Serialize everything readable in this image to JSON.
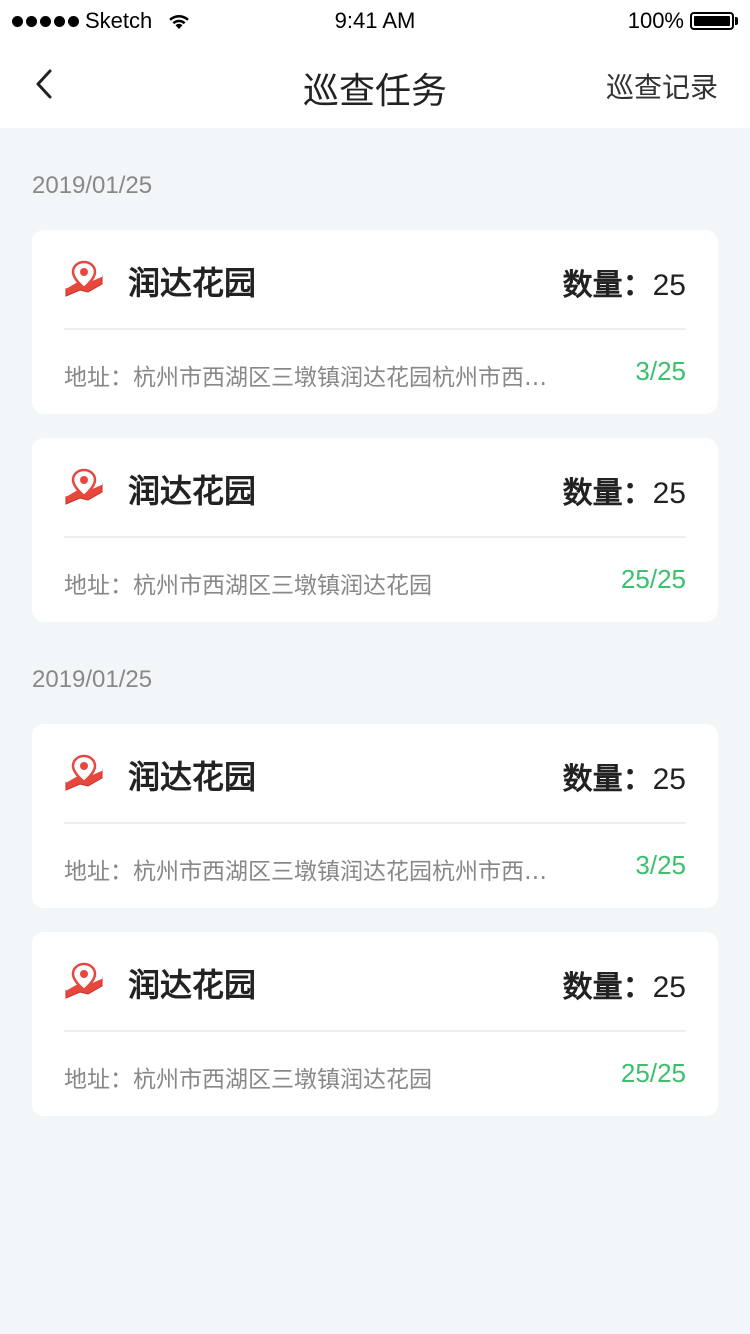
{
  "status_bar": {
    "carrier": "Sketch",
    "time": "9:41 AM",
    "battery": "100%"
  },
  "nav": {
    "title": "巡查任务",
    "right_action": "巡查记录"
  },
  "groups": [
    {
      "date": "2019/01/25",
      "tasks": [
        {
          "name": "润达花园",
          "qty_label": "数量：",
          "qty_value": "25",
          "address": "地址：杭州市西湖区三墩镇润达花园杭州市西湖区三墩镇润达花园",
          "progress": "3/25"
        },
        {
          "name": "润达花园",
          "qty_label": "数量：",
          "qty_value": "25",
          "address": "地址：杭州市西湖区三墩镇润达花园",
          "progress": "25/25"
        }
      ]
    },
    {
      "date": "2019/01/25",
      "tasks": [
        {
          "name": "润达花园",
          "qty_label": "数量：",
          "qty_value": "25",
          "address": "地址：杭州市西湖区三墩镇润达花园杭州市西湖区三墩镇润达花园",
          "progress": "3/25"
        },
        {
          "name": "润达花园",
          "qty_label": "数量：",
          "qty_value": "25",
          "address": "地址：杭州市西湖区三墩镇润达花园",
          "progress": "25/25"
        }
      ]
    }
  ],
  "colors": {
    "background": "#f3f6f9",
    "progress_green": "#3bc16c",
    "pin_red": "#e8473d"
  },
  "icons": {
    "back": "chevron-left-icon",
    "location": "map-pin-icon"
  }
}
